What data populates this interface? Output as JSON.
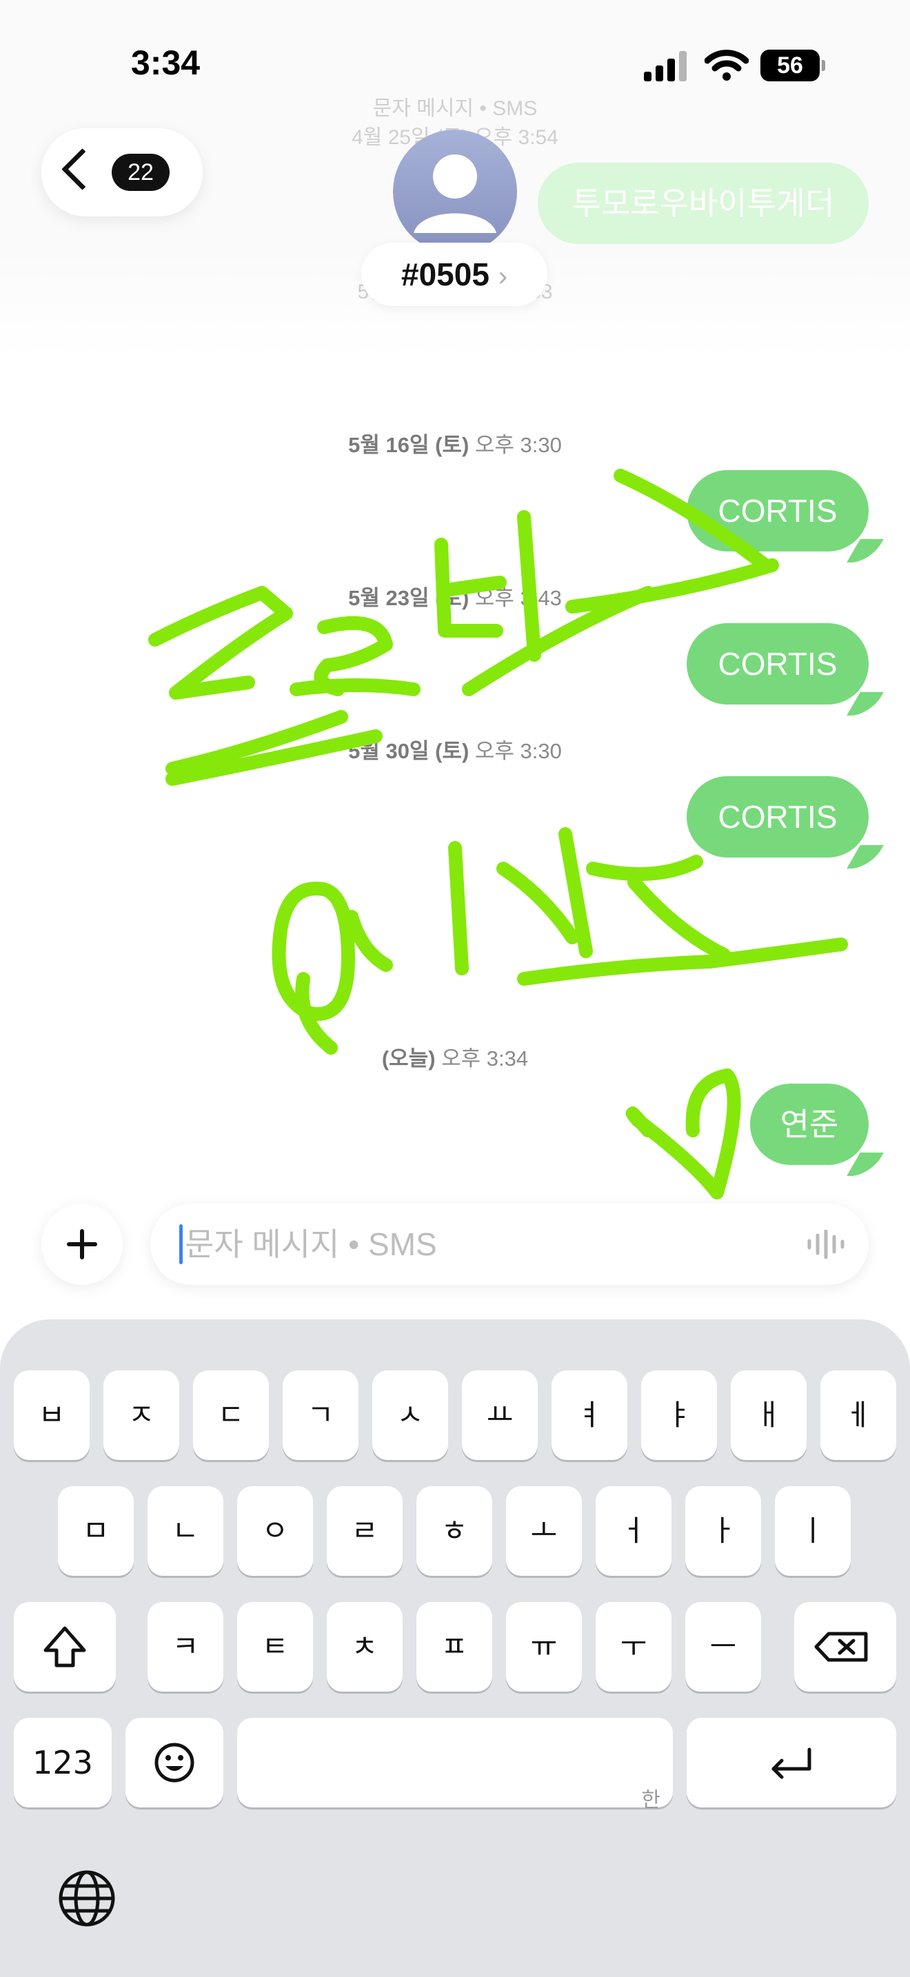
{
  "status_bar": {
    "time": "3:34",
    "battery": "56"
  },
  "header": {
    "back_count": "22",
    "contact_name": "#0505",
    "contact_chevron": "›",
    "behind_channel": "문자 메시지 • SMS",
    "behind_date": "4월 25일 (토) 오후 3:54",
    "behind_bubble": "투모로우바이투게더",
    "behind_date2": "5월 9일 (토) 오후 3:53"
  },
  "messages": [
    {
      "timestamp_date": "5월 16일 (토)",
      "timestamp_time": "오후 3:30",
      "text": "CORTIS"
    },
    {
      "timestamp_date": "5월 23일 (토)",
      "timestamp_time": "오후 3:43",
      "text": "CORTIS"
    },
    {
      "timestamp_date": "5월 30일 (토)",
      "timestamp_time": "오후 3:30",
      "text": "CORTIS"
    },
    {
      "timestamp_date": "(오늘)",
      "timestamp_time": "오후 3:34",
      "text": "연준"
    }
  ],
  "composer": {
    "placeholder": "문자 메시지 • SMS"
  },
  "keyboard": {
    "row1": [
      "ㅂ",
      "ㅈ",
      "ㄷ",
      "ㄱ",
      "ㅅ",
      "ㅛ",
      "ㅕ",
      "ㅑ",
      "ㅐ",
      "ㅔ"
    ],
    "row2": [
      "ㅁ",
      "ㄴ",
      "ㅇ",
      "ㄹ",
      "ㅎ",
      "ㅗ",
      "ㅓ",
      "ㅏ",
      "ㅣ"
    ],
    "row3": [
      "ㅋ",
      "ㅌ",
      "ㅊ",
      "ㅍ",
      "ㅠ",
      "ㅜ",
      "ㅡ"
    ],
    "numbers_label": "123",
    "space_hint": "한"
  },
  "colors": {
    "bubble": "#77d97c",
    "ink": "#85e80a",
    "keyboard_bg": "#e2e3e6"
  }
}
